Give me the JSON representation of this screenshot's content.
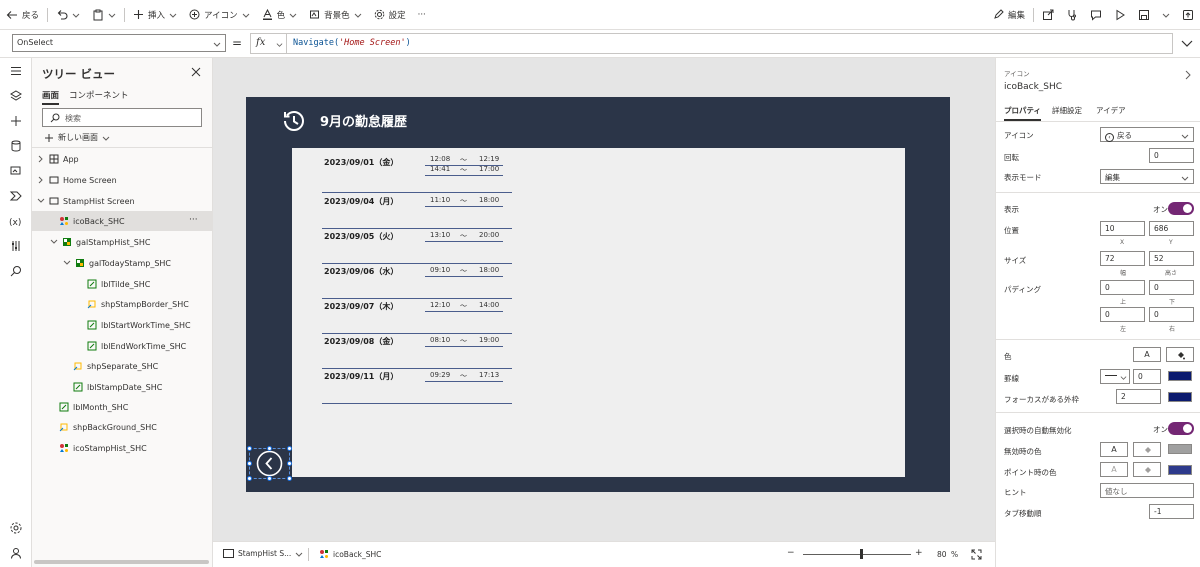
{
  "toolbar": {
    "back": "戻る",
    "insert": "挿入",
    "icon": "アイコン",
    "color": "色",
    "bgcolor": "背景色",
    "settings": "設定",
    "more": "···",
    "edit": "編集"
  },
  "formula": {
    "property": "OnSelect",
    "eq": "=",
    "fx": "fx",
    "code_prefix": "Navigate(",
    "code_string": "'Home Screen'",
    "code_suffix": ")"
  },
  "tree": {
    "title": "ツリー ビュー",
    "tab_screens": "画面",
    "tab_components": "コンポーネント",
    "search_placeholder": "検索",
    "new_screen": "新しい画面",
    "items": [
      {
        "label": "App"
      },
      {
        "label": "Home Screen"
      },
      {
        "label": "StampHist Screen"
      },
      {
        "label": "icoBack_SHC"
      },
      {
        "label": "galStampHist_SHC"
      },
      {
        "label": "galTodayStamp_SHC"
      },
      {
        "label": "lblTilde_SHC"
      },
      {
        "label": "shpStampBorder_SHC"
      },
      {
        "label": "lblStartWorkTime_SHC"
      },
      {
        "label": "lblEndWorkTime_SHC"
      },
      {
        "label": "shpSeparate_SHC"
      },
      {
        "label": "lblStampDate_SHC"
      },
      {
        "label": "lblMonth_SHC"
      },
      {
        "label": "shpBackGround_SHC"
      },
      {
        "label": "icoStampHist_SHC"
      }
    ],
    "selected_more": "···"
  },
  "app": {
    "title": "9月の勤怠履歴",
    "tilde": "～",
    "rows": [
      {
        "date": "2023/09/01（金）",
        "times": [
          [
            "12:08",
            "12:19"
          ],
          [
            "14:41",
            "17:00"
          ]
        ]
      },
      {
        "date": "2023/09/04（月）",
        "times": [
          [
            "11:10",
            "18:00"
          ]
        ]
      },
      {
        "date": "2023/09/05（火）",
        "times": [
          [
            "13:10",
            "20:00"
          ]
        ]
      },
      {
        "date": "2023/09/06（水）",
        "times": [
          [
            "09:10",
            "18:00"
          ]
        ]
      },
      {
        "date": "2023/09/07（木）",
        "times": [
          [
            "12:10",
            "14:00"
          ]
        ]
      },
      {
        "date": "2023/09/08（金）",
        "times": [
          [
            "08:10",
            "19:00"
          ]
        ]
      },
      {
        "date": "2023/09/11（月）",
        "times": [
          [
            "09:29",
            "17:13"
          ]
        ]
      }
    ]
  },
  "status": {
    "screen": "StampHist S...",
    "control": "icoBack_SHC",
    "minus": "−",
    "plus": "+",
    "zoom": "80",
    "pct": "%",
    "zoom_level": 0.8
  },
  "props": {
    "header_small": "アイコン",
    "name": "icoBack_SHC",
    "tab_properties": "プロパティ",
    "tab_advanced": "詳細設定",
    "tab_ideas": "アイデア",
    "icon_label": "アイコン",
    "icon_value": "戻る",
    "rotation_label": "回転",
    "rotation_value": "0",
    "mode_label": "表示モード",
    "mode_value": "編集",
    "visible_label": "表示",
    "on": "オン",
    "position_label": "位置",
    "x_value": "10",
    "y_value": "686",
    "x": "X",
    "y": "Y",
    "size_label": "サイズ",
    "w_value": "72",
    "h_value": "52",
    "width": "幅",
    "height": "高さ",
    "padding_label": "パディング",
    "pad_top": "0",
    "pad_bottom": "0",
    "pad_left": "0",
    "pad_right": "0",
    "top": "上",
    "bottom": "下",
    "left": "左",
    "right": "右",
    "color_label": "色",
    "border_label": "罫線",
    "border_value": "0",
    "focus_label": "フォーカスがある外枠",
    "focus_value": "2",
    "autodisable_label": "選択時の自動無効化",
    "disabled_color_label": "無効時の色",
    "hover_color_label": "ポイント時の色",
    "hint_label": "ヒント",
    "hint_value": "値なし",
    "tab_index_label": "タブ移動順",
    "tab_index_value": "-1",
    "font_a": "A",
    "colors": {
      "border": "#0b1a6e",
      "focus": "#0b1a6e",
      "disabled": "#a0a0a0",
      "hover": "#2e3a8c",
      "accent": "#742774"
    }
  }
}
